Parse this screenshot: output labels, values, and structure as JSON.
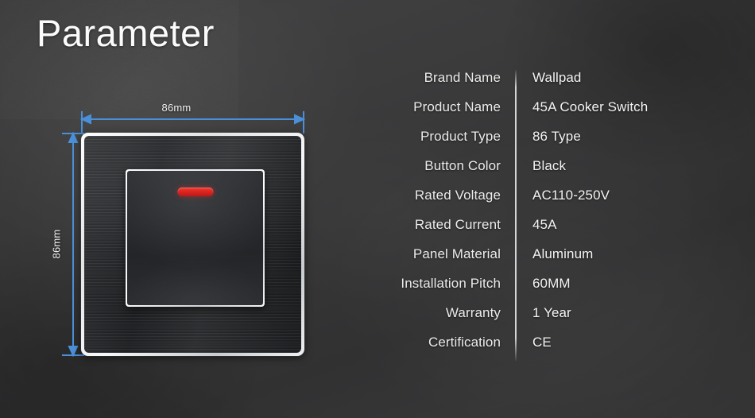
{
  "header": {
    "title": "Parameter"
  },
  "diagram": {
    "width_label": "86mm",
    "height_label": "86mm",
    "dimension_color": "#4a90d9",
    "product": {
      "panel_color": "#23252a",
      "frame_color": "#e9ebec",
      "led_color": "#dc2420"
    }
  },
  "spec_table": {
    "divider_color": "#e2e2e2",
    "rows": [
      {
        "label": "Brand Name",
        "value": "Wallpad"
      },
      {
        "label": "Product Name",
        "value": "45A Cooker Switch"
      },
      {
        "label": "Product Type",
        "value": "86 Type"
      },
      {
        "label": "Button Color",
        "value": "Black"
      },
      {
        "label": "Rated Voltage",
        "value": "AC110-250V"
      },
      {
        "label": "Rated Current",
        "value": "45A"
      },
      {
        "label": "Panel Material",
        "value": "Aluminum"
      },
      {
        "label": "Installation Pitch",
        "value": "60MM"
      },
      {
        "label": "Warranty",
        "value": "1 Year"
      },
      {
        "label": "Certification",
        "value": "CE"
      }
    ]
  }
}
